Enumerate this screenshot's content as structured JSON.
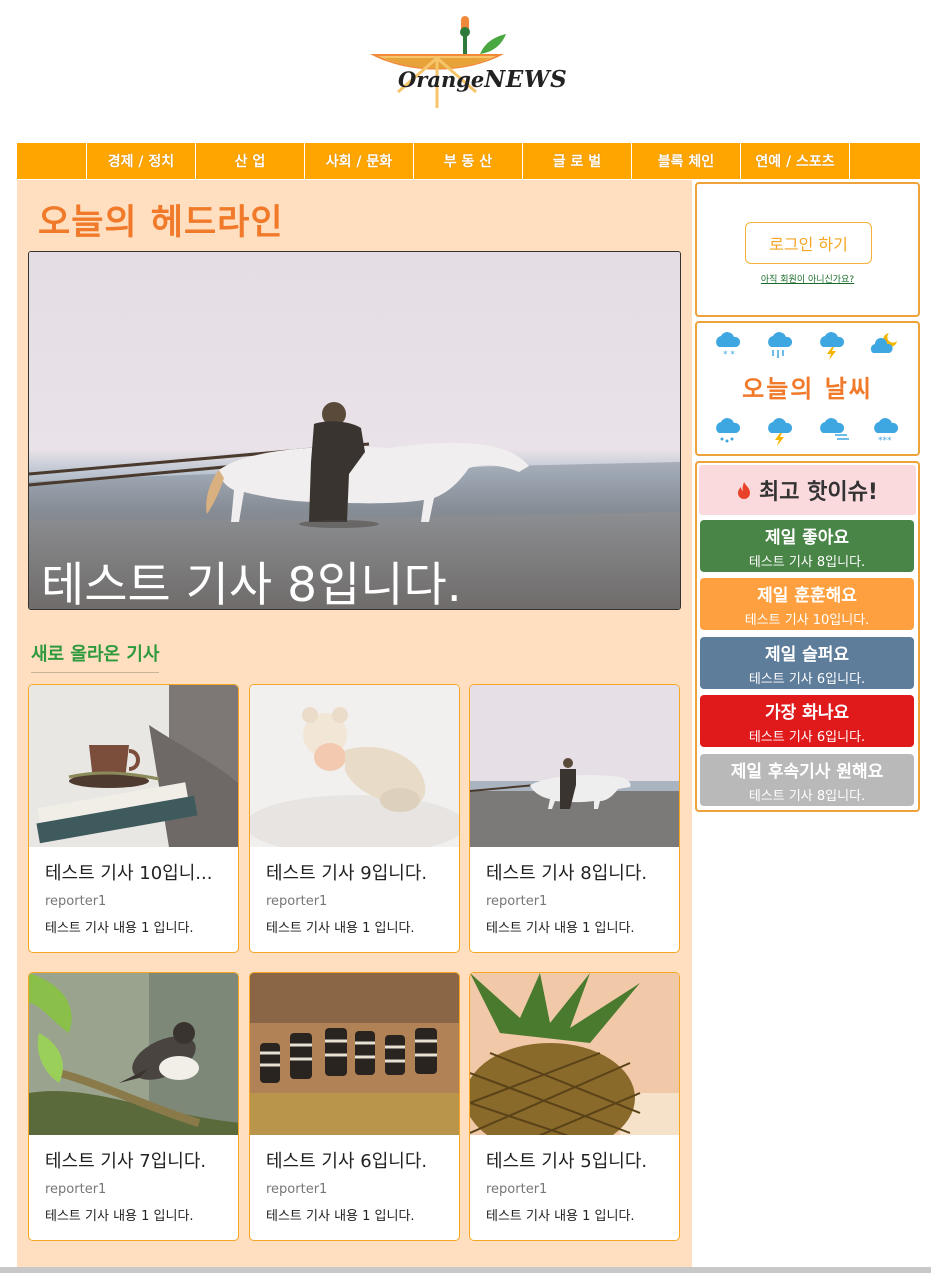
{
  "logo": {
    "text_orange": "Orange",
    "text_news": "NEWS",
    "alt": "Orange NEWS"
  },
  "nav": {
    "items": [
      {
        "label": "경제 / 정치"
      },
      {
        "label": "산 업"
      },
      {
        "label": "사회 / 문화"
      },
      {
        "label": "부 동 산"
      },
      {
        "label": "글 로 벌"
      },
      {
        "label": "블록 체인"
      },
      {
        "label": "연예 / 스포츠"
      }
    ]
  },
  "headline": {
    "section_title": "오늘의 헤드라인",
    "caption": "테스트 기사 8입니다."
  },
  "new_articles": {
    "section_title": "새로 올라온 기사",
    "cards": [
      {
        "title": "테스트 기사 10입니...",
        "reporter": "reporter1",
        "body": "테스트 기사 내용 1 입니다.",
        "image": "coffee-books"
      },
      {
        "title": "테스트 기사 9입니다.",
        "reporter": "reporter1",
        "body": "테스트 기사 내용 1 입니다.",
        "image": "sleeping-baby"
      },
      {
        "title": "테스트 기사 8입니다.",
        "reporter": "reporter1",
        "body": "테스트 기사 내용 1 입니다.",
        "image": "man-horse-beach"
      },
      {
        "title": "테스트 기사 7입니다.",
        "reporter": "reporter1",
        "body": "테스트 기사 내용 1 입니다.",
        "image": "bird-branch"
      },
      {
        "title": "테스트 기사 6입니다.",
        "reporter": "reporter1",
        "body": "테스트 기사 내용 1 입니다.",
        "image": "zebras"
      },
      {
        "title": "테스트 기사 5입니다.",
        "reporter": "reporter1",
        "body": "테스트 기사 내용 1 입니다.",
        "image": "pineapple"
      }
    ]
  },
  "login": {
    "button_label": "로그인 하기",
    "signup_link": "아직 회원이 아니신가요?"
  },
  "weather": {
    "title": "오늘의 날씨",
    "icons": [
      "snow-cloud-icon",
      "rain-cloud-icon",
      "thunder-cloud-icon",
      "night-cloud-icon",
      "rain-cloud-icon",
      "thunder-cloud-icon",
      "wind-cloud-icon",
      "snow-cloud-icon"
    ]
  },
  "hot_issue": {
    "title": "최고 핫이슈!",
    "items": [
      {
        "label": "제일 좋아요",
        "article": "테스트 기사 8입니다.",
        "color": "#4a8548"
      },
      {
        "label": "제일 훈훈해요",
        "article": "테스트 기사 10입니다.",
        "color": "#ffa040"
      },
      {
        "label": "제일 슬퍼요",
        "article": "테스트 기사 6입니다.",
        "color": "#5e7d9b"
      },
      {
        "label": "가장 화나요",
        "article": "테스트 기사 6입니다.",
        "color": "#e0191b"
      },
      {
        "label": "제일 후속기사 원해요",
        "article": "테스트 기사 8입니다.",
        "color": "#b9b9b9"
      }
    ]
  },
  "colors": {
    "nav": "#ffa500",
    "main_bg": "#ffdfbf",
    "headline": "#f07a2a",
    "new_title": "#2e9a3e",
    "border": "#f0a23a"
  }
}
